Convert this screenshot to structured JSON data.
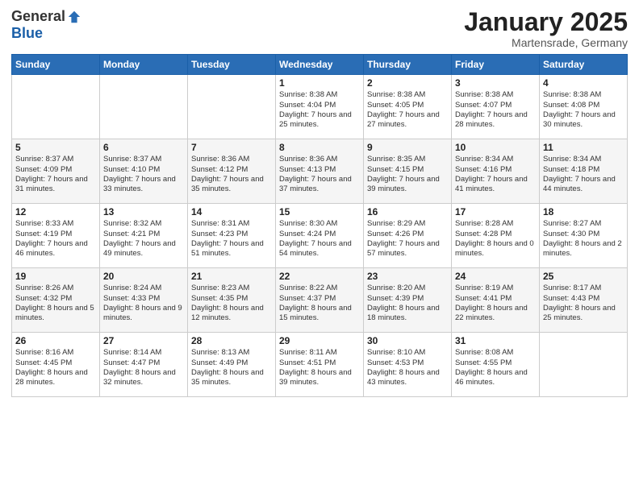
{
  "logo": {
    "general": "General",
    "blue": "Blue"
  },
  "title": "January 2025",
  "location": "Martensrade, Germany",
  "days_header": [
    "Sunday",
    "Monday",
    "Tuesday",
    "Wednesday",
    "Thursday",
    "Friday",
    "Saturday"
  ],
  "weeks": [
    [
      {
        "day": "",
        "info": ""
      },
      {
        "day": "",
        "info": ""
      },
      {
        "day": "",
        "info": ""
      },
      {
        "day": "1",
        "info": "Sunrise: 8:38 AM\nSunset: 4:04 PM\nDaylight: 7 hours\nand 25 minutes."
      },
      {
        "day": "2",
        "info": "Sunrise: 8:38 AM\nSunset: 4:05 PM\nDaylight: 7 hours\nand 27 minutes."
      },
      {
        "day": "3",
        "info": "Sunrise: 8:38 AM\nSunset: 4:07 PM\nDaylight: 7 hours\nand 28 minutes."
      },
      {
        "day": "4",
        "info": "Sunrise: 8:38 AM\nSunset: 4:08 PM\nDaylight: 7 hours\nand 30 minutes."
      }
    ],
    [
      {
        "day": "5",
        "info": "Sunrise: 8:37 AM\nSunset: 4:09 PM\nDaylight: 7 hours\nand 31 minutes."
      },
      {
        "day": "6",
        "info": "Sunrise: 8:37 AM\nSunset: 4:10 PM\nDaylight: 7 hours\nand 33 minutes."
      },
      {
        "day": "7",
        "info": "Sunrise: 8:36 AM\nSunset: 4:12 PM\nDaylight: 7 hours\nand 35 minutes."
      },
      {
        "day": "8",
        "info": "Sunrise: 8:36 AM\nSunset: 4:13 PM\nDaylight: 7 hours\nand 37 minutes."
      },
      {
        "day": "9",
        "info": "Sunrise: 8:35 AM\nSunset: 4:15 PM\nDaylight: 7 hours\nand 39 minutes."
      },
      {
        "day": "10",
        "info": "Sunrise: 8:34 AM\nSunset: 4:16 PM\nDaylight: 7 hours\nand 41 minutes."
      },
      {
        "day": "11",
        "info": "Sunrise: 8:34 AM\nSunset: 4:18 PM\nDaylight: 7 hours\nand 44 minutes."
      }
    ],
    [
      {
        "day": "12",
        "info": "Sunrise: 8:33 AM\nSunset: 4:19 PM\nDaylight: 7 hours\nand 46 minutes."
      },
      {
        "day": "13",
        "info": "Sunrise: 8:32 AM\nSunset: 4:21 PM\nDaylight: 7 hours\nand 49 minutes."
      },
      {
        "day": "14",
        "info": "Sunrise: 8:31 AM\nSunset: 4:23 PM\nDaylight: 7 hours\nand 51 minutes."
      },
      {
        "day": "15",
        "info": "Sunrise: 8:30 AM\nSunset: 4:24 PM\nDaylight: 7 hours\nand 54 minutes."
      },
      {
        "day": "16",
        "info": "Sunrise: 8:29 AM\nSunset: 4:26 PM\nDaylight: 7 hours\nand 57 minutes."
      },
      {
        "day": "17",
        "info": "Sunrise: 8:28 AM\nSunset: 4:28 PM\nDaylight: 8 hours\nand 0 minutes."
      },
      {
        "day": "18",
        "info": "Sunrise: 8:27 AM\nSunset: 4:30 PM\nDaylight: 8 hours\nand 2 minutes."
      }
    ],
    [
      {
        "day": "19",
        "info": "Sunrise: 8:26 AM\nSunset: 4:32 PM\nDaylight: 8 hours\nand 5 minutes."
      },
      {
        "day": "20",
        "info": "Sunrise: 8:24 AM\nSunset: 4:33 PM\nDaylight: 8 hours\nand 9 minutes."
      },
      {
        "day": "21",
        "info": "Sunrise: 8:23 AM\nSunset: 4:35 PM\nDaylight: 8 hours\nand 12 minutes."
      },
      {
        "day": "22",
        "info": "Sunrise: 8:22 AM\nSunset: 4:37 PM\nDaylight: 8 hours\nand 15 minutes."
      },
      {
        "day": "23",
        "info": "Sunrise: 8:20 AM\nSunset: 4:39 PM\nDaylight: 8 hours\nand 18 minutes."
      },
      {
        "day": "24",
        "info": "Sunrise: 8:19 AM\nSunset: 4:41 PM\nDaylight: 8 hours\nand 22 minutes."
      },
      {
        "day": "25",
        "info": "Sunrise: 8:17 AM\nSunset: 4:43 PM\nDaylight: 8 hours\nand 25 minutes."
      }
    ],
    [
      {
        "day": "26",
        "info": "Sunrise: 8:16 AM\nSunset: 4:45 PM\nDaylight: 8 hours\nand 28 minutes."
      },
      {
        "day": "27",
        "info": "Sunrise: 8:14 AM\nSunset: 4:47 PM\nDaylight: 8 hours\nand 32 minutes."
      },
      {
        "day": "28",
        "info": "Sunrise: 8:13 AM\nSunset: 4:49 PM\nDaylight: 8 hours\nand 35 minutes."
      },
      {
        "day": "29",
        "info": "Sunrise: 8:11 AM\nSunset: 4:51 PM\nDaylight: 8 hours\nand 39 minutes."
      },
      {
        "day": "30",
        "info": "Sunrise: 8:10 AM\nSunset: 4:53 PM\nDaylight: 8 hours\nand 43 minutes."
      },
      {
        "day": "31",
        "info": "Sunrise: 8:08 AM\nSunset: 4:55 PM\nDaylight: 8 hours\nand 46 minutes."
      },
      {
        "day": "",
        "info": ""
      }
    ]
  ]
}
